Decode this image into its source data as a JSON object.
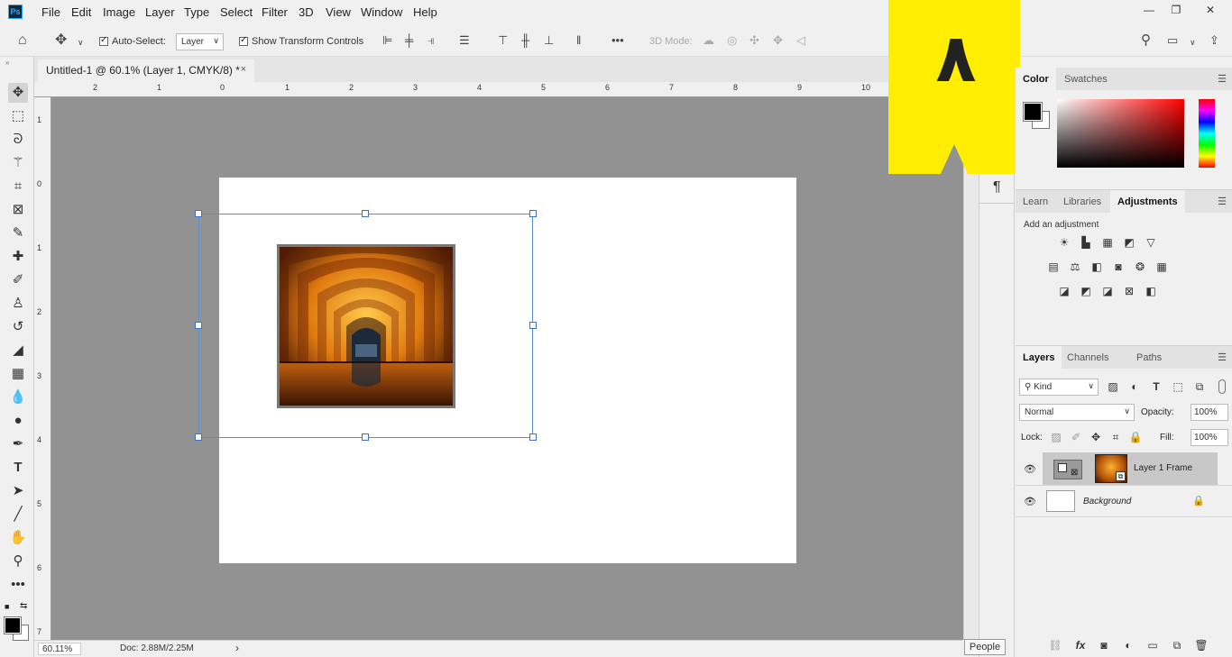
{
  "app": {
    "logo": "Ps"
  },
  "menu": [
    "File",
    "Edit",
    "Image",
    "Layer",
    "Type",
    "Select",
    "Filter",
    "3D",
    "View",
    "Window",
    "Help"
  ],
  "window_controls": {
    "minimize": "—",
    "restore": "❐",
    "close": "✕"
  },
  "options": {
    "auto_select_label": "Auto-Select:",
    "auto_select_target": "Layer",
    "show_transform_label": "Show Transform Controls",
    "mode_3d_label": "3D Mode:",
    "more": "•••"
  },
  "document": {
    "tab_title": "Untitled-1 @ 60.1% (Layer 1, CMYK/8) *",
    "close": "×",
    "zoom": "60.11%",
    "doc_size": "Doc: 2.88M/2.25M",
    "arrow": "›"
  },
  "rulers": {
    "h": [
      "2",
      "1",
      "0",
      "1",
      "2",
      "3",
      "4",
      "5",
      "6",
      "7",
      "8",
      "9",
      "10"
    ],
    "v": [
      "1",
      "0",
      "1",
      "2",
      "3",
      "4",
      "5",
      "6",
      "7"
    ]
  },
  "banner": {
    "text": "٨",
    "color": "#ffee00"
  },
  "color_panel": {
    "tabs": [
      "Color",
      "Swatches"
    ],
    "active": "Color",
    "foreground": "#000000",
    "background": "#ffffff",
    "picker_hue": "#ff0000"
  },
  "adjustments_panel": {
    "tabs": [
      "Learn",
      "Libraries",
      "Adjustments"
    ],
    "active": "Adjustments",
    "hint": "Add an adjustment",
    "icons_row1": [
      "brightness-icon",
      "levels-icon",
      "curves-icon",
      "exposure-icon",
      "vibrance-icon"
    ],
    "icons_row2": [
      "hue-sat-icon",
      "color-balance-icon",
      "black-white-icon",
      "photo-filter-icon",
      "channel-mixer-icon",
      "color-lookup-icon"
    ],
    "icons_row3": [
      "invert-icon",
      "posterize-icon",
      "threshold-icon",
      "selective-color-icon",
      "gradient-map-icon"
    ]
  },
  "layers_panel": {
    "tabs": [
      "Layers",
      "Channels",
      "Paths"
    ],
    "active": "Layers",
    "filter_kind": "Kind",
    "blend_mode": "Normal",
    "opacity_label": "Opacity:",
    "opacity": "100%",
    "lock_label": "Lock:",
    "fill_label": "Fill:",
    "fill": "100%",
    "layers": [
      {
        "name": "Layer 1 Frame",
        "selected": true,
        "italic": false
      },
      {
        "name": "Background",
        "selected": false,
        "italic": true
      }
    ]
  },
  "dock": {
    "paragraph": "¶"
  },
  "people_button": "People"
}
